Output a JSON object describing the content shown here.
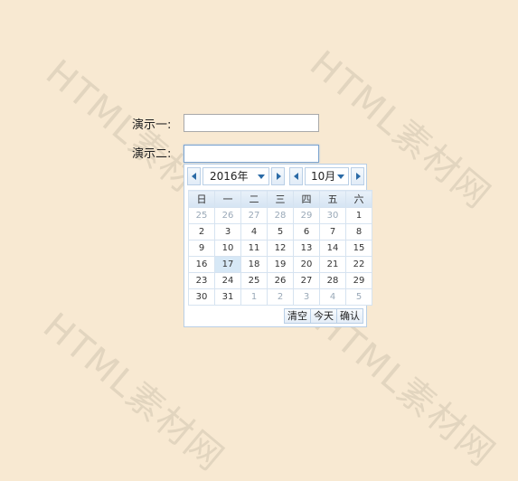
{
  "watermark": "HTML素材网",
  "form": {
    "demo1_label": "演示一:",
    "demo2_label": "演示二:",
    "demo1_value": "",
    "demo2_value": ""
  },
  "calendar": {
    "year_label": "2016年",
    "month_label": "10月",
    "weekdays": [
      "日",
      "一",
      "二",
      "三",
      "四",
      "五",
      "六"
    ],
    "weeks": [
      [
        {
          "d": "25",
          "o": true
        },
        {
          "d": "26",
          "o": true
        },
        {
          "d": "27",
          "o": true
        },
        {
          "d": "28",
          "o": true
        },
        {
          "d": "29",
          "o": true
        },
        {
          "d": "30",
          "o": true
        },
        {
          "d": "1",
          "o": false
        }
      ],
      [
        {
          "d": "2",
          "o": false
        },
        {
          "d": "3",
          "o": false
        },
        {
          "d": "4",
          "o": false
        },
        {
          "d": "5",
          "o": false
        },
        {
          "d": "6",
          "o": false
        },
        {
          "d": "7",
          "o": false
        },
        {
          "d": "8",
          "o": false
        }
      ],
      [
        {
          "d": "9",
          "o": false
        },
        {
          "d": "10",
          "o": false
        },
        {
          "d": "11",
          "o": false
        },
        {
          "d": "12",
          "o": false
        },
        {
          "d": "13",
          "o": false
        },
        {
          "d": "14",
          "o": false
        },
        {
          "d": "15",
          "o": false
        }
      ],
      [
        {
          "d": "16",
          "o": false
        },
        {
          "d": "17",
          "o": false,
          "today": true
        },
        {
          "d": "18",
          "o": false
        },
        {
          "d": "19",
          "o": false
        },
        {
          "d": "20",
          "o": false
        },
        {
          "d": "21",
          "o": false
        },
        {
          "d": "22",
          "o": false
        }
      ],
      [
        {
          "d": "23",
          "o": false
        },
        {
          "d": "24",
          "o": false
        },
        {
          "d": "25",
          "o": false
        },
        {
          "d": "26",
          "o": false
        },
        {
          "d": "27",
          "o": false
        },
        {
          "d": "28",
          "o": false
        },
        {
          "d": "29",
          "o": false
        }
      ],
      [
        {
          "d": "30",
          "o": false
        },
        {
          "d": "31",
          "o": false
        },
        {
          "d": "1",
          "o": true
        },
        {
          "d": "2",
          "o": true
        },
        {
          "d": "3",
          "o": true
        },
        {
          "d": "4",
          "o": true
        },
        {
          "d": "5",
          "o": true
        }
      ]
    ],
    "clear_label": "清空",
    "today_label": "今天",
    "confirm_label": "确认",
    "accent_color": "#2a6aa6",
    "today_color": "#d7e8f6"
  }
}
